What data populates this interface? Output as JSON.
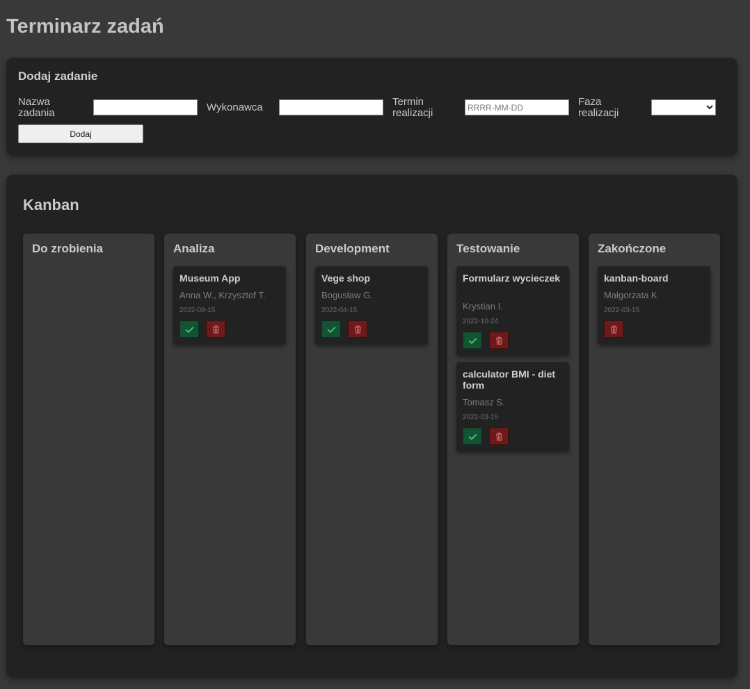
{
  "page": {
    "title": "Terminarz zadań"
  },
  "form": {
    "title": "Dodaj zadanie",
    "fields": {
      "task_name": {
        "label_line1": "Nazwa",
        "label_line2": "zadania",
        "value": "",
        "placeholder": ""
      },
      "assignee": {
        "label": "Wykonawca",
        "value": "",
        "placeholder": ""
      },
      "deadline": {
        "label_line1": "Termin",
        "label_line2": "realizacji",
        "value": "",
        "placeholder": "RRRR-MM-DD"
      },
      "phase": {
        "label_line1": "Faza",
        "label_line2": "realizacji",
        "selected": ""
      }
    },
    "add_button_label": "Dodaj"
  },
  "kanban": {
    "title": "Kanban",
    "columns": [
      {
        "title": "Do zrobienia",
        "cards": []
      },
      {
        "title": "Analiza",
        "cards": [
          {
            "title": "Museum App",
            "person": "Anna W., Krzysztof T.",
            "date": "2022-08-15",
            "has_done_button": true,
            "has_delete_button": true
          }
        ]
      },
      {
        "title": "Development",
        "cards": [
          {
            "title": "Vege shop",
            "person": "Bogusław G.",
            "date": "2022-04-15",
            "has_done_button": true,
            "has_delete_button": true
          }
        ]
      },
      {
        "title": "Testowanie",
        "cards": [
          {
            "title": "Formularz wycieczek",
            "person": "Krystian I.",
            "date": "2022-10-24",
            "has_done_button": true,
            "has_delete_button": true
          },
          {
            "title": "calculator BMI - diet form",
            "person": "Tomasz S.",
            "date": "2022-03-15",
            "has_done_button": true,
            "has_delete_button": true
          }
        ]
      },
      {
        "title": "Zakończone",
        "cards": [
          {
            "title": "kanban-board",
            "person": "Małgorzata K",
            "date": "2022-03-15",
            "has_done_button": false,
            "has_delete_button": true
          }
        ]
      }
    ]
  },
  "icons": {
    "done": "check-icon",
    "delete": "trash-icon"
  },
  "colors": {
    "background": "#393939",
    "panel": "#222222",
    "done_button": "#135232",
    "delete_button": "#6b1b1b",
    "done_icon": "#3fbf6f",
    "delete_icon": "#d46a6a"
  }
}
